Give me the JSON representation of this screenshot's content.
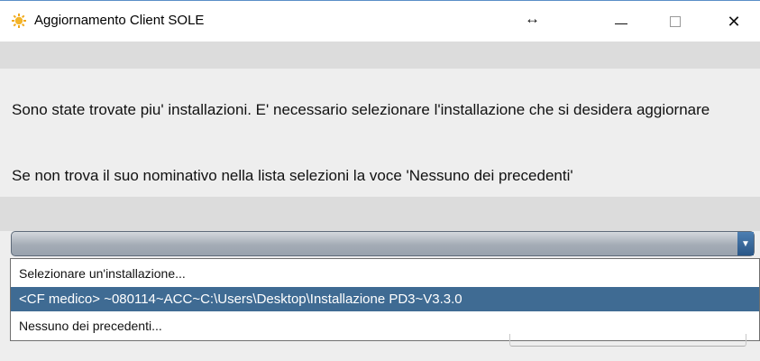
{
  "window": {
    "title": "Aggiornamento Client SOLE",
    "app_icon": "sun-gear-icon",
    "resize_icon": "↔",
    "controls": {
      "minimize": "minimize-icon",
      "maximize": "maximize-icon",
      "close": "✕"
    }
  },
  "message": {
    "line1": "Sono state trovate piu' installazioni. E' necessario selezionare l'installazione che si desidera aggiornare",
    "line2": "Se non trova il suo nominativo nella lista selezioni la voce 'Nessuno dei precedenti'"
  },
  "combo": {
    "selected_value": "",
    "arrow": "▼"
  },
  "dropdown": {
    "items": [
      {
        "label": "Selezionare un'installazione..."
      },
      {
        "label": "<CF medico> ~080114~ACC~C:\\Users\\Desktop\\Installazione PD3~V3.3.0",
        "selected": true
      },
      {
        "label": "Nessuno dei precedenti..."
      }
    ]
  },
  "colors": {
    "selection": "#3f6b93",
    "window_bg": "#eeeeee",
    "icon_accent": "#f0a91e"
  }
}
